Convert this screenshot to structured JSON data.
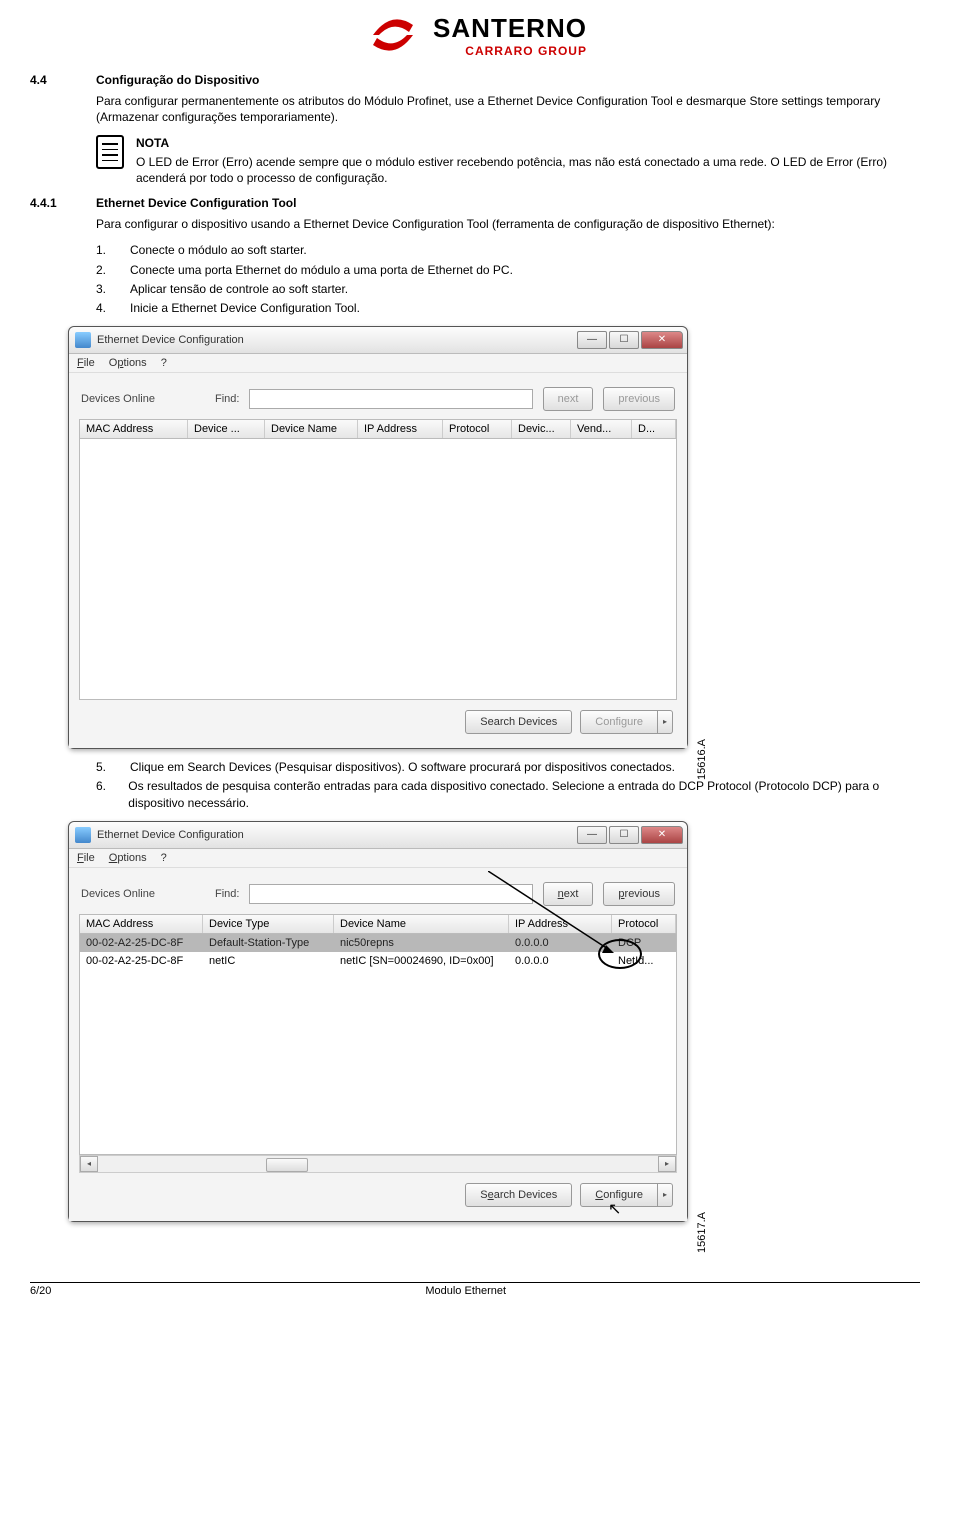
{
  "logo": {
    "name": "SANTERNO",
    "subtitle": "CARRARO GROUP"
  },
  "section": {
    "num": "4.4",
    "title": "Configuração do Dispositivo",
    "intro": "Para configurar permanentemente os atributos do Módulo Profinet, use a Ethernet Device Configuration Tool e desmarque Store settings temporary (Armazenar configurações temporariamente)."
  },
  "note": {
    "heading": "NOTA",
    "body": "O LED de Error (Erro) acende sempre que o módulo estiver recebendo potência, mas não está conectado a uma rede.   O LED de Error (Erro) acenderá por todo o processo de configuração."
  },
  "subsection": {
    "num": "4.4.1",
    "title": "Ethernet Device Configuration Tool",
    "intro": "Para configurar o dispositivo usando a Ethernet Device Configuration Tool (ferramenta de configuração de dispositivo Ethernet):",
    "steps_a": [
      {
        "n": "1.",
        "t": "Conecte o módulo ao soft starter."
      },
      {
        "n": "2.",
        "t": "Conecte uma porta Ethernet do módulo a uma porta de Ethernet do PC."
      },
      {
        "n": "3.",
        "t": "Aplicar tensão de controle ao soft starter."
      },
      {
        "n": "4.",
        "t": "Inicie a Ethernet Device Configuration Tool."
      }
    ],
    "steps_b": [
      {
        "n": "5.",
        "t": "Clique em Search Devices (Pesquisar dispositivos).   O software procurará por dispositivos conectados."
      },
      {
        "n": "6.",
        "t": "Os resultados de pesquisa conterão entradas para cada dispositivo conectado.   Selecione a entrada do DCP Protocol (Protocolo DCP) para o dispositivo necessário."
      }
    ]
  },
  "win1": {
    "title": "Ethernet Device Configuration",
    "menu": {
      "file": "File",
      "options": "Options",
      "help": "?"
    },
    "devices_label": "Devices Online",
    "find_label": "Find:",
    "btn_next": "next",
    "btn_prev": "previous",
    "cols": [
      "MAC Address",
      "Device ...",
      "Device Name",
      "IP Address",
      "Protocol",
      "Devic...",
      "Vend...",
      "D..."
    ],
    "btn_search": "Search Devices",
    "btn_configure": "Configure",
    "sidelabel": "15616.A"
  },
  "win2": {
    "title": "Ethernet Device Configuration",
    "menu": {
      "file": "File",
      "options": "Options",
      "help": "?"
    },
    "devices_label": "Devices Online",
    "find_label": "Find:",
    "btn_next": "next",
    "btn_prev": "previous",
    "cols": [
      "MAC Address",
      "Device Type",
      "Device Name",
      "IP Address",
      "Protocol"
    ],
    "rows": [
      {
        "mac": "00-02-A2-25-DC-8F",
        "type": "Default-Station-Type",
        "name": "nic50repns",
        "ip": "0.0.0.0",
        "proto": "DCP"
      },
      {
        "mac": "00-02-A2-25-DC-8F",
        "type": "netIC",
        "name": "netIC [SN=00024690, ID=0x00]",
        "ip": "0.0.0.0",
        "proto": "NetId..."
      }
    ],
    "btn_search": "Search Devices",
    "btn_configure": "Configure",
    "sidelabel": "15617.A"
  },
  "footer": {
    "left": "6/20",
    "center": "Modulo Ethernet"
  }
}
